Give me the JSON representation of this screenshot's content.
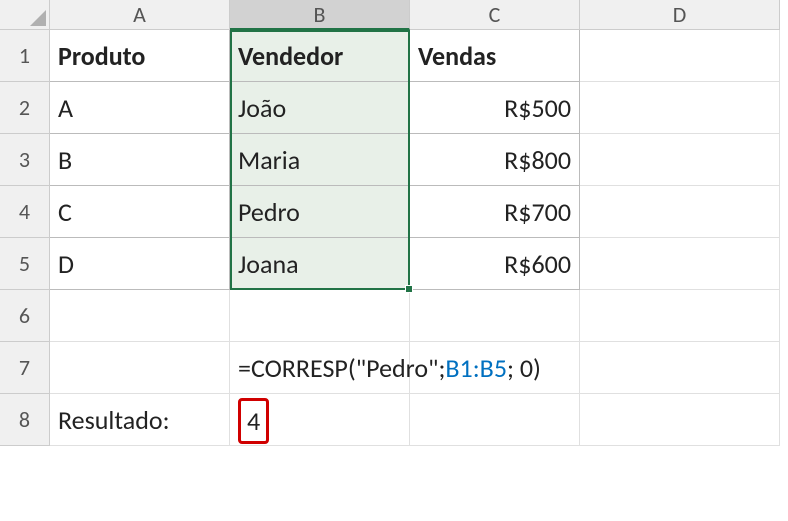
{
  "columns": [
    "A",
    "B",
    "C",
    "D"
  ],
  "rows": [
    "1",
    "2",
    "3",
    "4",
    "5",
    "6",
    "7",
    "8"
  ],
  "header": {
    "produto": "Produto",
    "vendedor": "Vendedor",
    "vendas": "Vendas"
  },
  "data": [
    {
      "produto": "A",
      "vendedor": "João",
      "vendas": "R$500"
    },
    {
      "produto": "B",
      "vendedor": "Maria",
      "vendas": "R$800"
    },
    {
      "produto": "C",
      "vendedor": "Pedro",
      "vendas": "R$700"
    },
    {
      "produto": "D",
      "vendedor": "Joana",
      "vendas": "R$600"
    }
  ],
  "formula": {
    "prefix": "=CORRESP(\"Pedro\";",
    "ref": "B1:B5",
    "suffix": "; 0)"
  },
  "result_label": "Resultado:",
  "result_value": "4",
  "chart_data": {
    "type": "table",
    "columns": [
      "Produto",
      "Vendedor",
      "Vendas"
    ],
    "rows": [
      [
        "A",
        "João",
        500
      ],
      [
        "B",
        "Maria",
        800
      ],
      [
        "C",
        "Pedro",
        700
      ],
      [
        "D",
        "Joana",
        600
      ]
    ],
    "currency": "R$",
    "formula": "=CORRESP(\"Pedro\";B1:B5; 0)",
    "result": 4
  }
}
